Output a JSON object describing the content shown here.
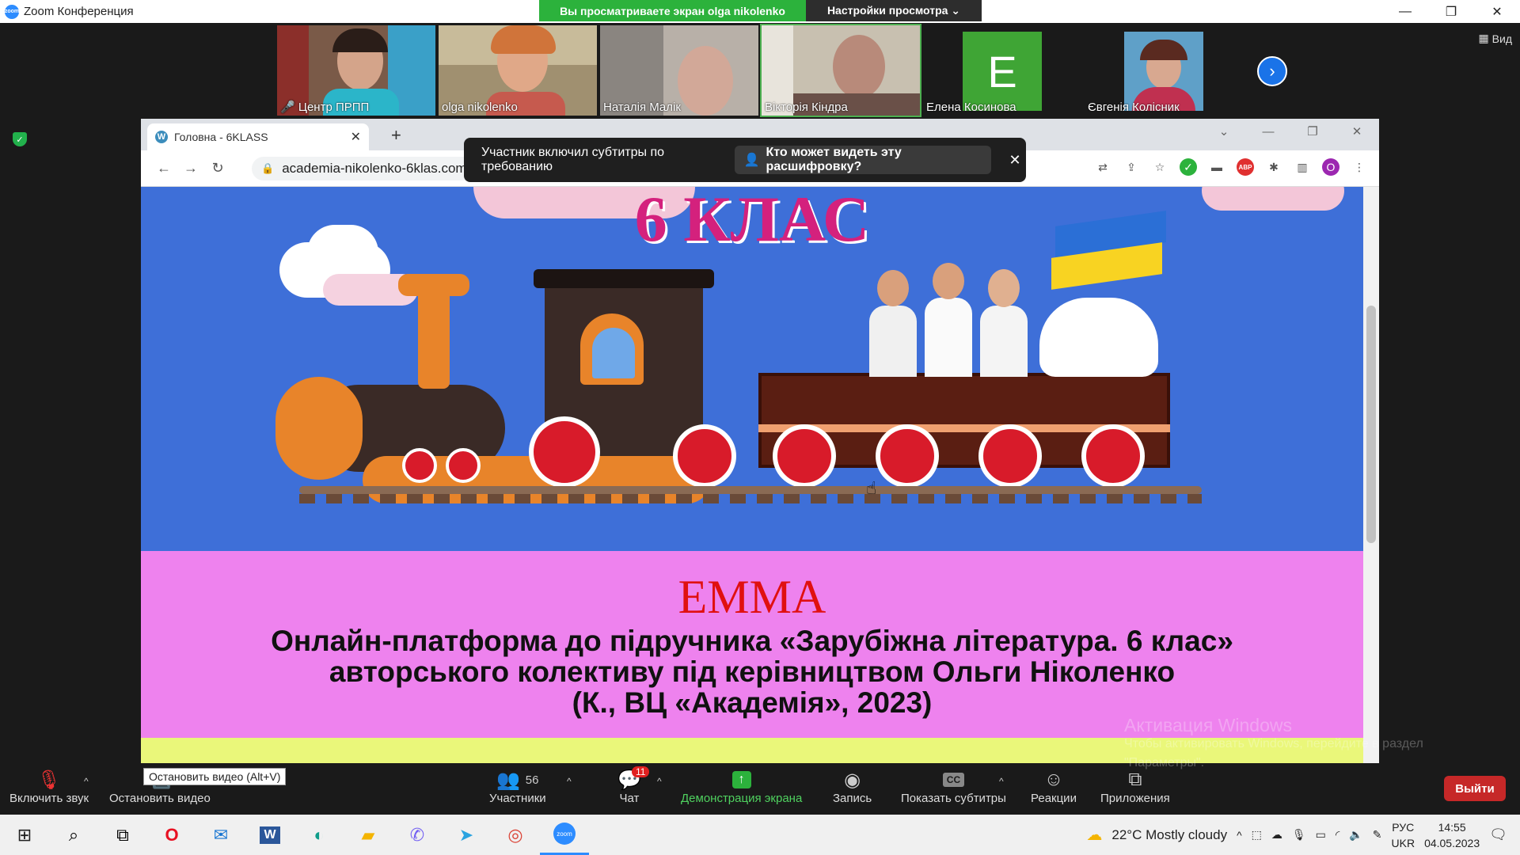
{
  "window": {
    "title": "Zoom Конференция",
    "minimize": "—",
    "maximize": "❐",
    "close": "✕"
  },
  "share_banner": {
    "viewing": "Вы просматриваете экран olga nikolenko",
    "view_settings": "Настройки просмотра ⌄"
  },
  "view_button": "Вид",
  "participants": [
    {
      "name": "Центр ПРПП",
      "muted": true
    },
    {
      "name": "olga nikolenko"
    },
    {
      "name": "Наталія Малік"
    },
    {
      "name": "Вікторія Кіндра",
      "active": true
    },
    {
      "name": "Елена Косинова",
      "avatar_letter": "E",
      "avatar_color": "#3fa535"
    },
    {
      "name": "Євгенія Колісник"
    }
  ],
  "browser": {
    "tab_title": "Головна - 6KLASS",
    "url": "academia-nikolenko-6klas.com.ua",
    "profile_letter": "O"
  },
  "caption_popup": {
    "text": "Участник включил субтитры по требованию",
    "button": "Кто может видеть эту расшифровку?"
  },
  "page": {
    "hero_title": "6 КЛАС",
    "brand": "EMMA",
    "line1": "Онлайн-платформа до підручника «Зарубіжна література. 6 клас»",
    "line2": "авторського колективу під керівництвом Ольги Ніколенко",
    "line3": "(К., ВЦ «Академія», 2023)"
  },
  "toolbar": {
    "unmute": "Включить звук",
    "stop_video": "Остановить видео",
    "participants": "Участники",
    "participants_count": "56",
    "chat": "Чат",
    "chat_badge": "11",
    "share": "Демонстрация экрана",
    "record": "Запись",
    "captions": "Показать субтитры",
    "reactions": "Реакции",
    "apps": "Приложения",
    "leave": "Выйти",
    "tooltip": "Остановить видео (Alt+V)"
  },
  "watermark": {
    "title": "Активация Windows",
    "line1": "Чтобы активировать Windows, перейдите в раздел",
    "line2": "\"Параметры\"."
  },
  "taskbar": {
    "weather": "22°C  Mostly cloudy",
    "lang_top": "РУС",
    "lang_bottom": "UKR",
    "time": "14:55",
    "date": "04.05.2023"
  },
  "colors": {
    "hero_bg": "#3e6fd8",
    "band_pink": "#ee82ee",
    "band_yellow": "#eaf77a",
    "brand_red": "#e01010",
    "share_green": "#2cb23c"
  }
}
